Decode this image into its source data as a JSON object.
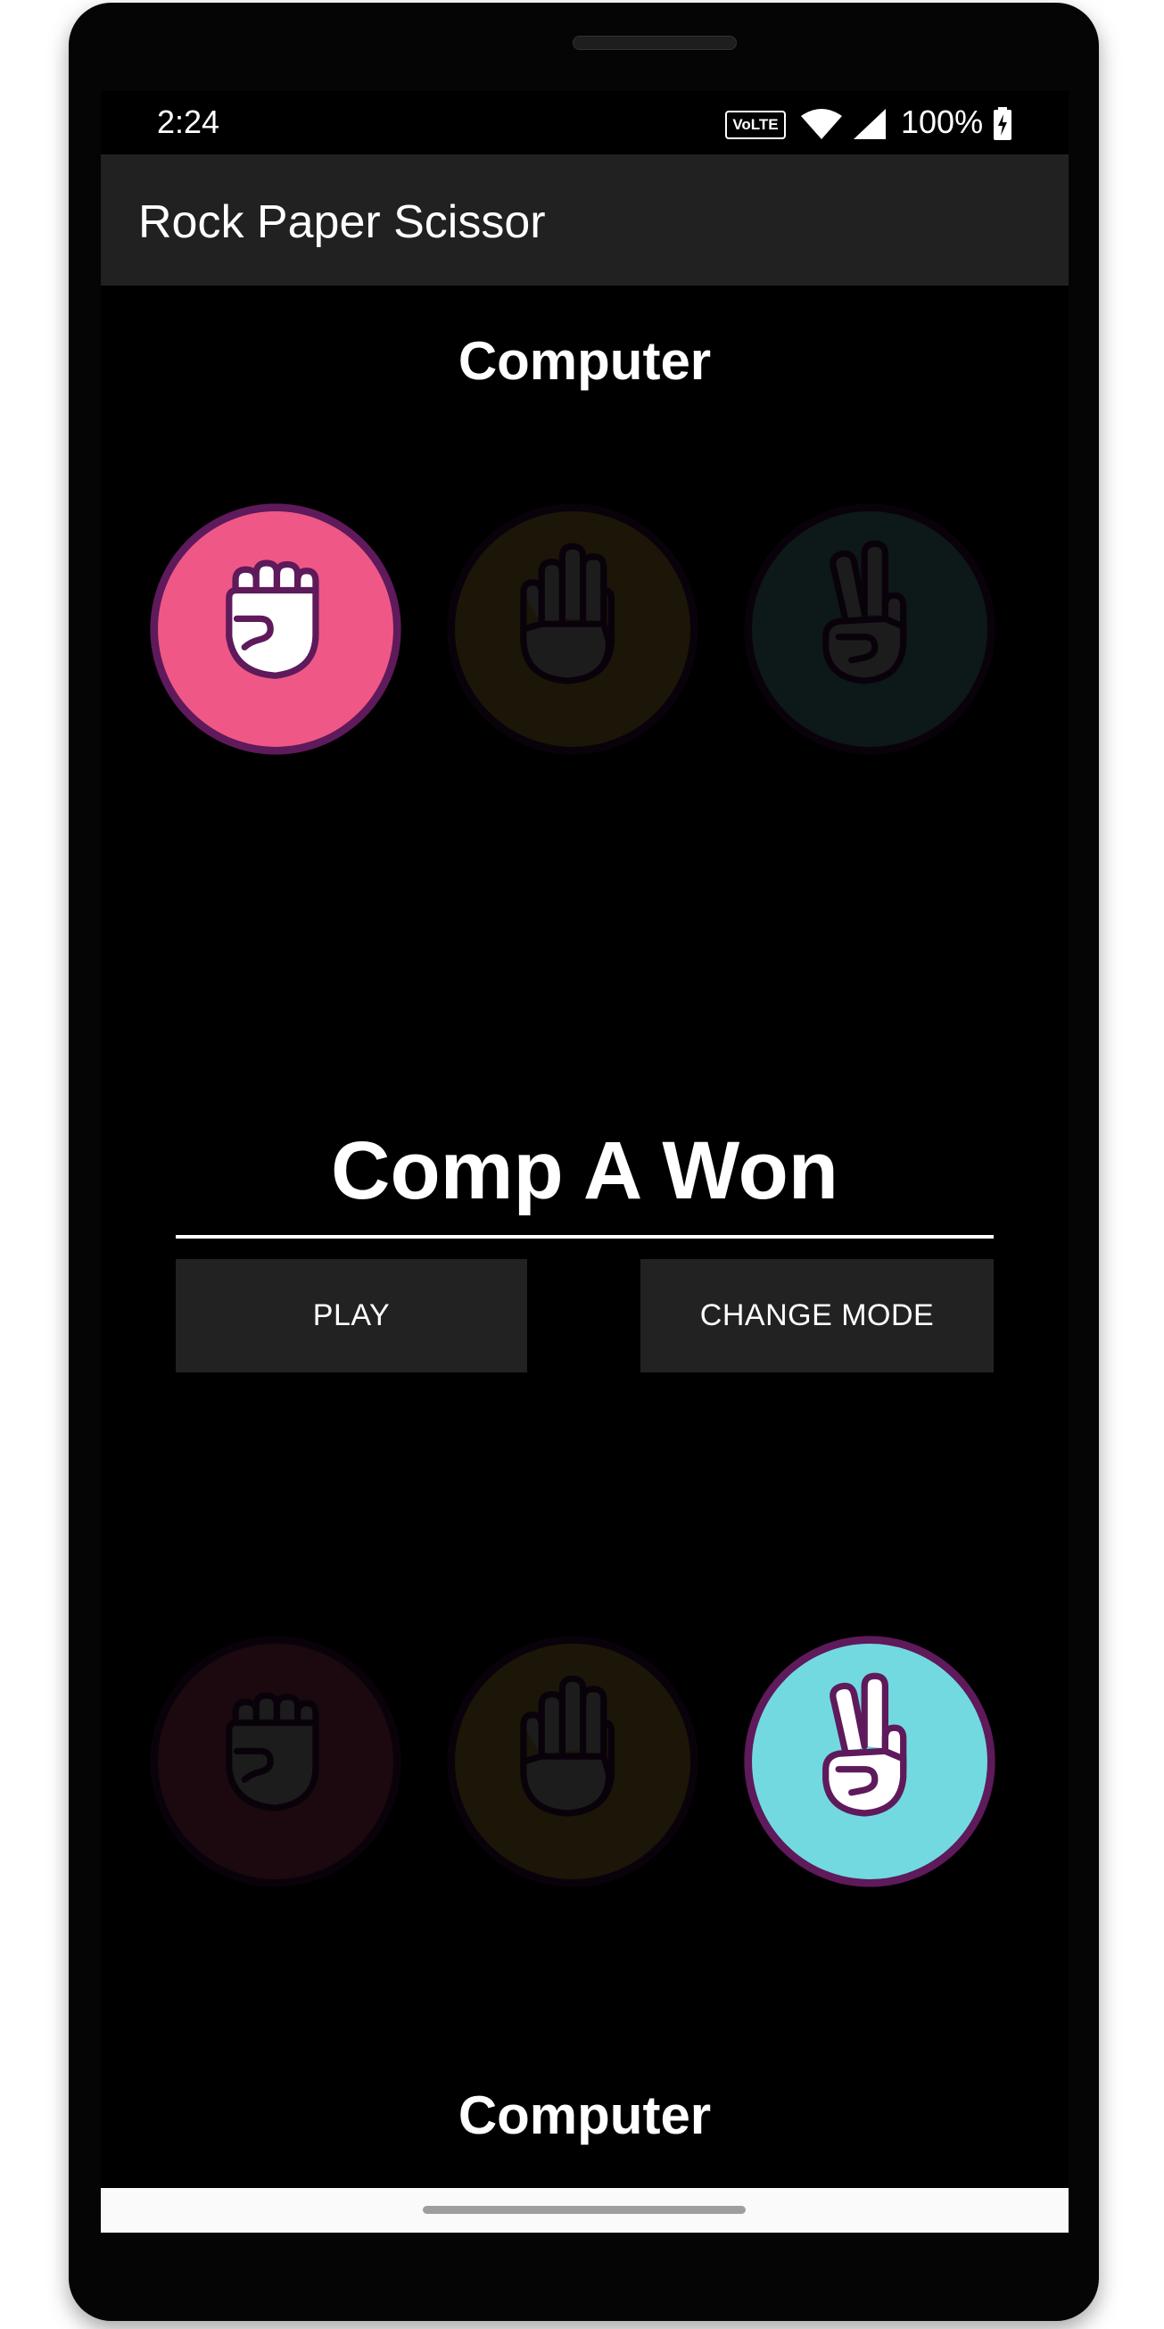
{
  "status_bar": {
    "time": "2:24",
    "volte": "VoLTE",
    "battery": "100%",
    "icons": [
      "wifi-icon",
      "signal-icon",
      "battery-charging-icon"
    ]
  },
  "app": {
    "title": "Rock Paper Scissor"
  },
  "top_player": {
    "label": "Computer",
    "choices": [
      {
        "name": "rock",
        "icon": "rock-fist-icon",
        "color": "#ef5886",
        "selected": true
      },
      {
        "name": "paper",
        "icon": "paper-hand-icon",
        "color": "#f6c945",
        "selected": false
      },
      {
        "name": "scissors",
        "icon": "scissors-hand-icon",
        "color": "#73d9e0",
        "selected": false
      }
    ]
  },
  "result": {
    "text": "Comp A Won"
  },
  "buttons": {
    "play": "PLAY",
    "change_mode": "CHANGE MODE"
  },
  "bottom_player": {
    "label": "Computer",
    "choices": [
      {
        "name": "rock",
        "icon": "rock-fist-icon",
        "color": "#ef5886",
        "selected": false
      },
      {
        "name": "paper",
        "icon": "paper-hand-icon",
        "color": "#f6c945",
        "selected": false
      },
      {
        "name": "scissors",
        "icon": "scissors-hand-icon",
        "color": "#73d9e0",
        "selected": true
      }
    ]
  },
  "colors": {
    "outline": "#5e1a5a",
    "app_bar": "#212121",
    "button": "#222222"
  }
}
